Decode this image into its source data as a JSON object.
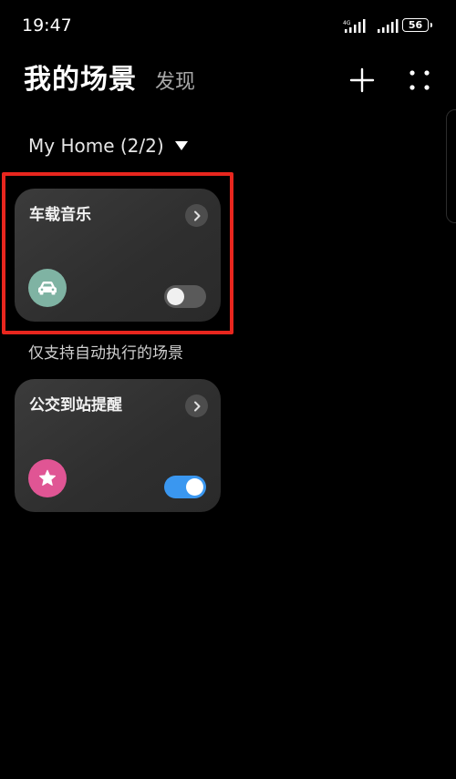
{
  "status_bar": {
    "time": "19:47",
    "battery": "56"
  },
  "header": {
    "active_tab": "我的场景",
    "inactive_tab": "发现"
  },
  "home_selector": {
    "label": "My Home (2/2)"
  },
  "scenes": [
    {
      "title": "车载音乐",
      "icon": "car-icon",
      "icon_color": "#7fb3a3",
      "enabled": false
    },
    {
      "title": "公交到站提醒",
      "icon": "star-icon",
      "icon_color": "#e05594",
      "enabled": true
    }
  ],
  "section_label": "仅支持自动执行的场景",
  "colors": {
    "highlight": "#e8261e",
    "toggle_on": "#3a97f0"
  }
}
